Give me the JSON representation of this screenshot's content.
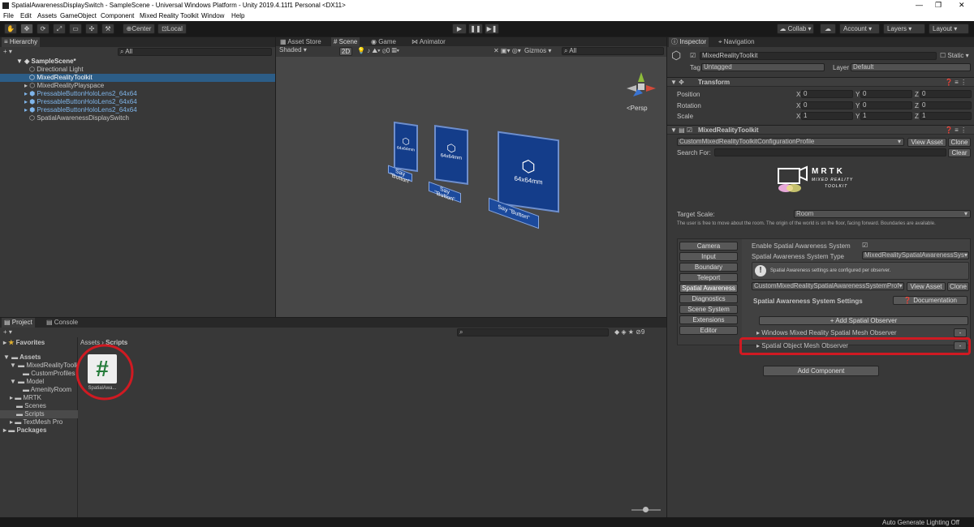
{
  "window": {
    "title": "SpatialAwarenessDisplaySwitch - SampleScene - Universal Windows Platform - Unity 2019.4.11f1 Personal <DX11>",
    "min": "—",
    "max": "❐",
    "close": "✕"
  },
  "menu": [
    "File",
    "Edit",
    "Assets",
    "GameObject",
    "Component",
    "Mixed Reality Toolkit",
    "Window",
    "Help"
  ],
  "toolbar": {
    "center": "Center",
    "local": "Local",
    "collab": "Collab ▾",
    "account": "Account",
    "layers": "Layers",
    "layout": "Layout",
    "play": "▶",
    "pause": "❚❚",
    "step": "▶❚"
  },
  "hierarchy": {
    "tab": "Hierarchy",
    "search_placeholder": "All",
    "scene": "SampleScene*",
    "items": [
      "Directional Light",
      "MixedRealityToolkit",
      "MixedRealityPlayspace",
      "PressableButtonHoloLens2_64x64",
      "PressableButtonHoloLens2_64x64",
      "PressableButtonHoloLens2_64x64",
      "SpatialAwarenessDisplaySwitch"
    ]
  },
  "scene_view": {
    "tabs": [
      "Asset Store",
      "Scene",
      "Game",
      "Animator"
    ],
    "shading": "Shaded",
    "mode2d": "2D",
    "gizmos": "Gizmos",
    "search_placeholder": "All",
    "persp": "<Persp",
    "cards": [
      "64x64mm",
      "64x64mm",
      "64x64mm"
    ],
    "plates": [
      "Say \"Button\"",
      "Say \"Button\"",
      "Say \"Button\""
    ]
  },
  "project": {
    "tabs": [
      "Project",
      "Console"
    ],
    "breadcrumb": [
      "Assets",
      "Scripts"
    ],
    "zoom_count": "9",
    "favorites": "Favorites",
    "tree": [
      "Assets",
      "MixedRealityToolkit",
      "CustomProfiles",
      "Model",
      "AmenityRoom",
      "MRTK",
      "Scenes",
      "Scripts",
      "TextMesh Pro",
      "Packages"
    ],
    "asset_name": "SpatialAwa...",
    "asset_glyph": "#"
  },
  "inspector": {
    "tabs": [
      "Inspector",
      "Navigation"
    ],
    "object_name": "MixedRealityToolkit",
    "static": "Static",
    "tag_label": "Tag",
    "tag": "Untagged",
    "layer_label": "Layer",
    "layer": "Default",
    "transform": {
      "title": "Transform",
      "position": "Position",
      "rotation": "Rotation",
      "scale": "Scale",
      "pos": [
        "0",
        "0",
        "0"
      ],
      "rot": [
        "0",
        "0",
        "0"
      ],
      "scl": [
        "1",
        "1",
        "1"
      ],
      "axes": [
        "X",
        "Y",
        "Z"
      ]
    },
    "mrtk": {
      "title": "MixedRealityToolkit",
      "profile": "CustomMixedRealityToolkitConfigurationProfile",
      "view_asset": "View Asset",
      "clone": "Clone",
      "search_for": "Search For:",
      "clear": "Clear",
      "logo_title": "MRTK",
      "logo_sub1": "MIXED REALITY",
      "logo_sub2": "TOOLKIT",
      "target_scale_label": "Target Scale:",
      "target_scale": "Room",
      "scale_desc": "The user is free to move about the room. The origin of the world is on the floor, facing forward. Boundaries are available.",
      "sections": [
        "Camera",
        "Input",
        "Boundary",
        "Teleport",
        "Spatial Awareness",
        "Diagnostics",
        "Scene System",
        "Extensions",
        "Editor"
      ],
      "enable_label": "Enable Spatial Awareness System",
      "system_type_label": "Spatial Awareness System Type",
      "system_type": "MixedRealitySpatialAwarenessSys▾",
      "info": "Spatial Awareness settings are configured per observer.",
      "sa_profile": "CustomMixedRealitySpatialAwarenessSystemProf▾",
      "settings_title": "Spatial Awareness System Settings",
      "documentation": "Documentation",
      "add_observer": "+ Add Spatial Observer",
      "observers": [
        "Windows Mixed Reality Spatial Mesh Observer",
        "Spatial Object Mesh Observer"
      ],
      "remove": "-"
    },
    "add_component": "Add Component"
  },
  "status": {
    "text": "Auto Generate Lighting Off"
  },
  "colors": {
    "highlight_circle": "#d01a22",
    "selection": "#2c5d87",
    "button_blue": "#143d8a"
  }
}
